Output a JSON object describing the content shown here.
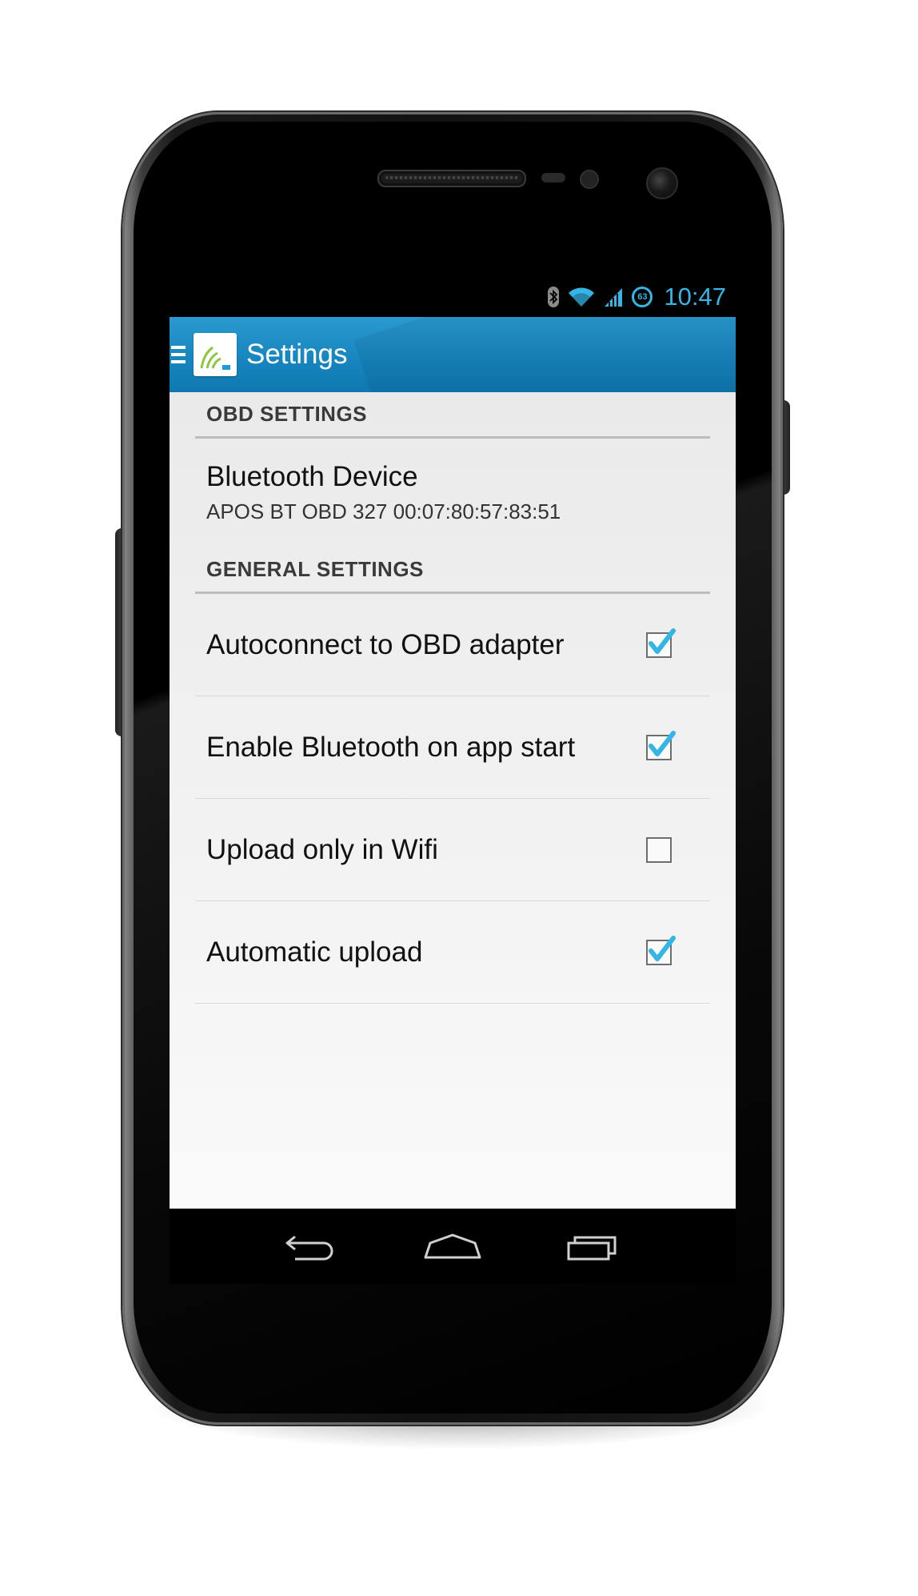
{
  "status_bar": {
    "time": "10:47",
    "battery_level": "63",
    "icons": [
      "bluetooth-icon",
      "wifi-icon",
      "signal-icon",
      "battery-icon"
    ],
    "accent_color": "#33b5e5"
  },
  "action_bar": {
    "title": "Settings",
    "background_color": "#1684bd",
    "icons": [
      "drawer-menu-icon",
      "app-logo-icon"
    ]
  },
  "preferences": {
    "obd_category": "OBD SETTINGS",
    "bluetooth_device": {
      "title": "Bluetooth Device",
      "summary": "APOS BT OBD 327 00:07:80:57:83:51"
    },
    "general_category": "GENERAL SETTINGS",
    "items": [
      {
        "label": "Autoconnect to OBD adapter",
        "checked": true
      },
      {
        "label": "Enable Bluetooth on app start",
        "checked": true
      },
      {
        "label": "Upload only in Wifi",
        "checked": false
      },
      {
        "label": "Automatic upload",
        "checked": true
      }
    ]
  },
  "nav_bar": {
    "icons": [
      "back-icon",
      "home-icon",
      "recent-apps-icon"
    ]
  }
}
